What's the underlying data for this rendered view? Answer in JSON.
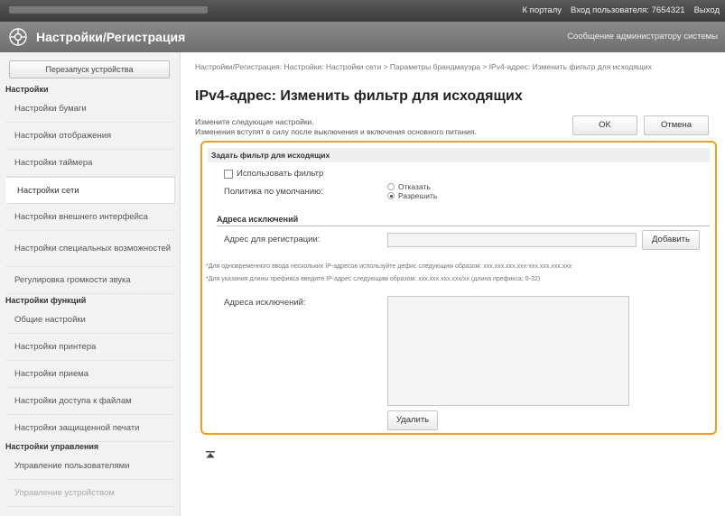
{
  "topbar": {
    "portal": "К порталу",
    "login_label": "Вход пользователя:",
    "user_id": "7654321",
    "logout": "Выход"
  },
  "header": {
    "title": "Настройки/Регистрация",
    "admin_message": "Сообщение администратору системы"
  },
  "sidebar": {
    "restart_label": "Перезапуск устройства",
    "section_settings": "Настройки",
    "items_settings": [
      "Настройки бумаги",
      "Настройки отображения",
      "Настройки таймера",
      "Настройки сети",
      "Настройки внешнего интерфейса",
      "Настройки специальных возможностей",
      "Регулировка громкости звука"
    ],
    "section_functions": "Настройки функций",
    "items_functions": [
      "Общие настройки",
      "Настройки принтера",
      "Настройки приема",
      "Настройки доступа к файлам",
      "Настройки защищенной печати"
    ],
    "section_management": "Настройки управления",
    "items_management": [
      "Управление пользователями",
      "Управление устройством"
    ]
  },
  "main": {
    "breadcrumb": "Настройки/Регистрация: Настройки: Настройки сети > Параметры брандмауэра > IPv4-адрес: Изменить фильтр для исходящих",
    "page_title": "IPv4-адрес: Изменить фильтр для исходящих",
    "desc_line1": "Измените следующие настройки.",
    "desc_line2": "Изменения вступят в силу после выключения и включения основного питания.",
    "ok_label": "OK",
    "cancel_label": "Отмена",
    "section_title": "Задать фильтр для исходящих",
    "use_filter_label": "Использовать фильтр",
    "use_filter_checked": false,
    "policy_label": "Политика по умолчанию:",
    "policy_options": [
      "Отказать",
      "Разрешить"
    ],
    "policy_selected": "Разрешить",
    "exceptions_heading": "Адреса исключений",
    "register_label": "Адрес для регистрации:",
    "register_value": "",
    "add_label": "Добавить",
    "note1": "*Для одновременного ввода нескольких IP-адресов используйте дефис следующим образом: xxx.xxx.xxx.xxx-xxx.xxx.xxx.xxx",
    "note2": "*Для указания длины префикса введите IP-адрес следующим образом: xxx.xxx.xxx.xxx/xx (длина префикса: 0-32)",
    "exceptions_label": "Адреса исключений:",
    "delete_label": "Удалить"
  },
  "colors": {
    "highlight_border": "#f0a020",
    "topbar": "#3c3c3c",
    "titlebar": "#6e6e6e"
  },
  "icons": [
    "settings-logo-icon",
    "to-top-icon"
  ]
}
